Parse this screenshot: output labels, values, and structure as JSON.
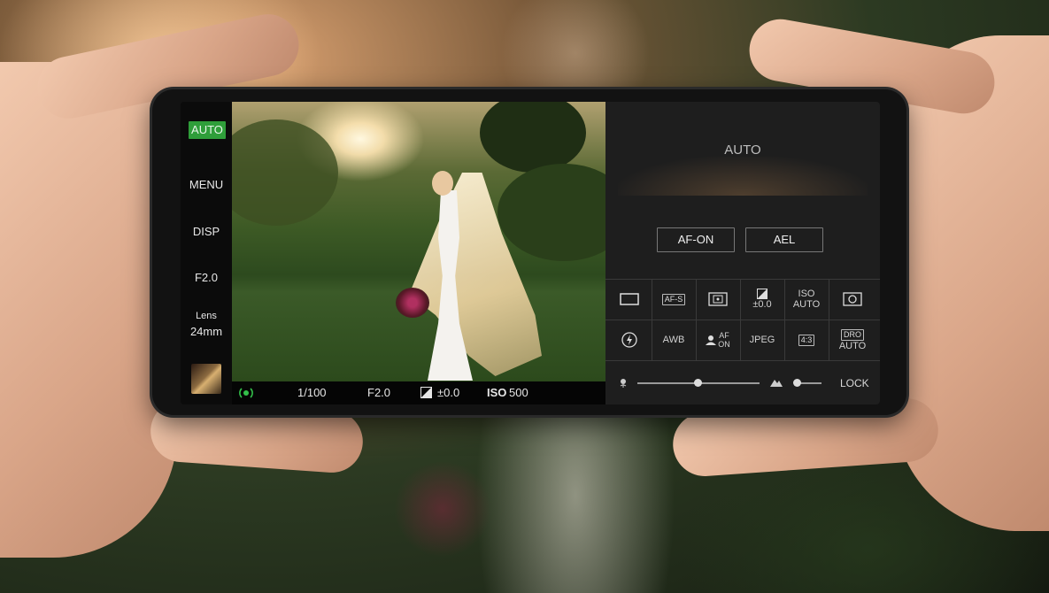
{
  "left_column": {
    "mode_badge": "AUTO",
    "menu": "MENU",
    "disp": "DISP",
    "aperture": "F2.0",
    "lens_label": "Lens",
    "lens_value": "24mm"
  },
  "status_bar": {
    "shutter": "1/100",
    "aperture": "F2.0",
    "exposure": "±0.0",
    "iso_label": "ISO",
    "iso_value": "500"
  },
  "panel": {
    "mode_title": "AUTO",
    "af_on": "AF-ON",
    "ael": "AEL",
    "row1": {
      "drive": "",
      "focus_mode": "AF-S",
      "metering": "",
      "exposure_comp": "±0.0",
      "iso_label": "ISO",
      "iso_value": "AUTO",
      "focus_area": ""
    },
    "row2": {
      "flash": "",
      "white_balance": "AWB",
      "face_eye_af": "AF ON",
      "file_format": "JPEG",
      "aspect_ratio": "4:3",
      "dro_label": "DRO",
      "dro_value": "AUTO"
    },
    "lock": "LOCK"
  },
  "colors": {
    "accent_green": "#2f9e3a",
    "panel_bg": "#1e1e1e"
  },
  "icons": [
    "live-view-icon",
    "exposure-comp-icon",
    "drive-single-icon",
    "metering-icon",
    "focus-area-icon",
    "flash-off-icon",
    "face-af-icon",
    "macro-flower-icon",
    "mountain-icon"
  ]
}
